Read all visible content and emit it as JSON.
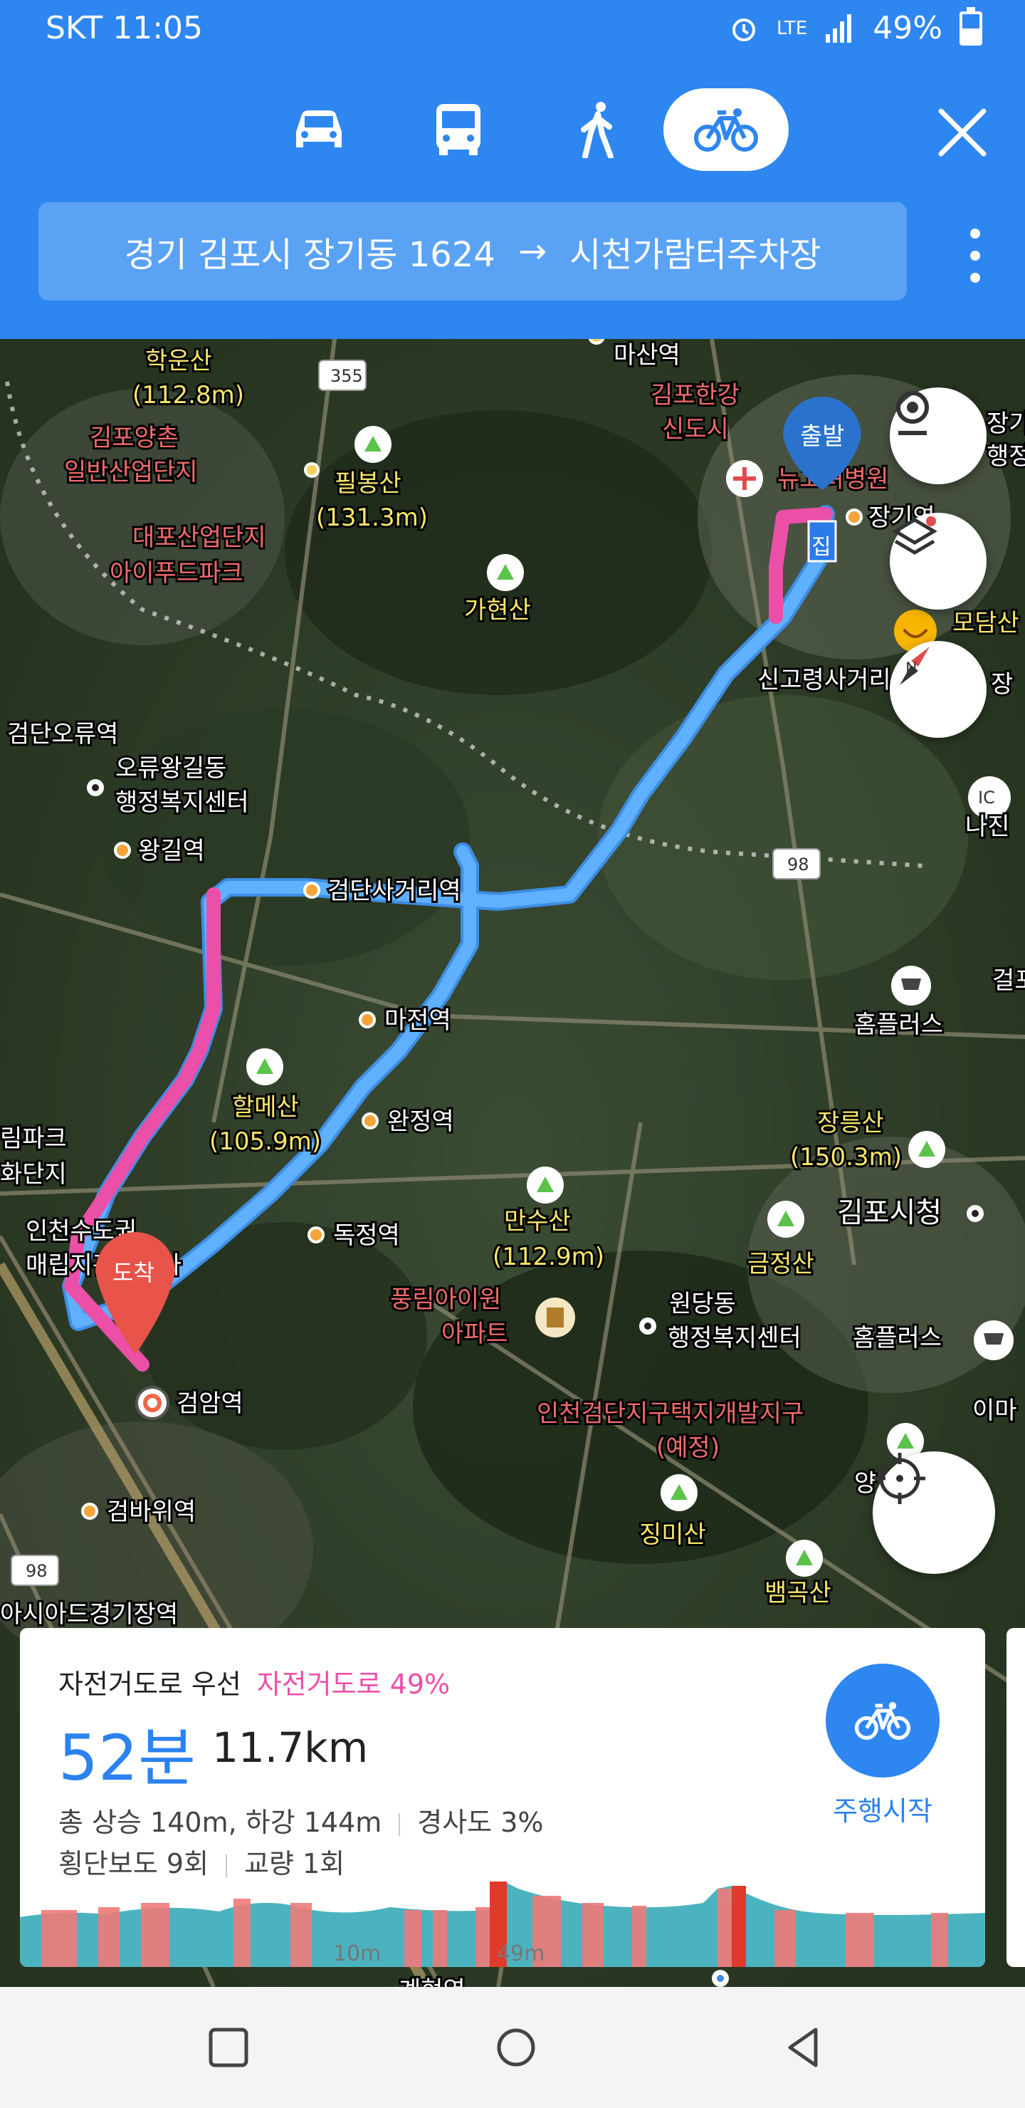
{
  "status": {
    "carrier_time": "SKT 11:05",
    "network": "LTE",
    "battery": "49%",
    "battery_level": 0.49
  },
  "header": {
    "modes": [
      {
        "name": "car",
        "active": false
      },
      {
        "name": "bus",
        "active": false
      },
      {
        "name": "walk",
        "active": false
      },
      {
        "name": "bicycle",
        "active": true
      }
    ],
    "origin": "경기 김포시 장기동 1624",
    "arrow": "→",
    "destination": "시천가람터주차장"
  },
  "map": {
    "markers": {
      "start": "출발",
      "end": "도착",
      "home": "집"
    },
    "labels": {
      "haksan": "학운산",
      "haksan_h": "(112.8m)",
      "yangchon1": "김포양촌",
      "yangchon2": "일반산업단지",
      "daepo": "대포산업단지",
      "ifood": "아이푸드파크",
      "pilbong": "필봉산",
      "pilbong_h": "(131.3m)",
      "gahyeon": "가현산",
      "masan": "마산역",
      "gimpo1": "김포한강",
      "gimpo2": "신도시",
      "newhospital": "뉴고려병원",
      "janggi": "장기역",
      "modam": "모담산",
      "singyo": "신고령사거리",
      "geomdan_oryu": "검단오류역",
      "oryu1": "오류왕길동",
      "oryu2": "행정복지센터",
      "wanggil": "왕길역",
      "geomdansa": "검단사거리역",
      "majeon": "마전역",
      "halme": "할메산",
      "halme_h": "(105.9m)",
      "wanjeong": "완정역",
      "dokjeong": "독정역",
      "mansu": "만수산",
      "mansu_h": "(112.9m)",
      "punglim1": "풍림아이원",
      "punglim2": "아파트",
      "incheon1": "인천수도권",
      "incheon2": "매립지관리공사",
      "left1": "림파크",
      "left2": "화단지",
      "geomam": "검암역",
      "geomba": "검바위역",
      "asiad": "아시아드경기장역",
      "wondang1": "원당동",
      "wondang2": "행정복지센터",
      "homeplus1": "홈플러스",
      "homeplus2": "홈플러스",
      "jangneung": "장릉산",
      "jangneung_h": "(150.3m)",
      "gimpo_city": "김포시청",
      "geumjeong": "금정산",
      "geomdan_dev1": "인천검단지구택지개발지구",
      "geomdan_dev2": "(예정)",
      "jingmi": "징미산",
      "baemgok": "뱀곡산",
      "najin": "나진",
      "gulpo": "걸포",
      "ima": "이마",
      "yang": "양",
      "jang": "장기",
      "jang2": "행정",
      "jang3": "장",
      "road355": "355",
      "road98a": "98",
      "road98b": "98",
      "ic": "IC",
      "gyehyeon": "계현역"
    }
  },
  "card": {
    "title": "자전거도로 우선",
    "bike_pct": "자전거도로 49%",
    "time": "52분",
    "distance": "11.7km",
    "elevation": "총 상승 140m, 하강 144m",
    "slope": "경사도 3%",
    "crosswalk": "횡단보도 9회",
    "bridge": "교량 1회",
    "start_button": "주행시작",
    "profile_ticks": [
      "10m",
      "49m"
    ]
  },
  "colors": {
    "primary": "#2e86f0",
    "bike_route": "#ec4fa8",
    "route": "#4aa3f5"
  }
}
